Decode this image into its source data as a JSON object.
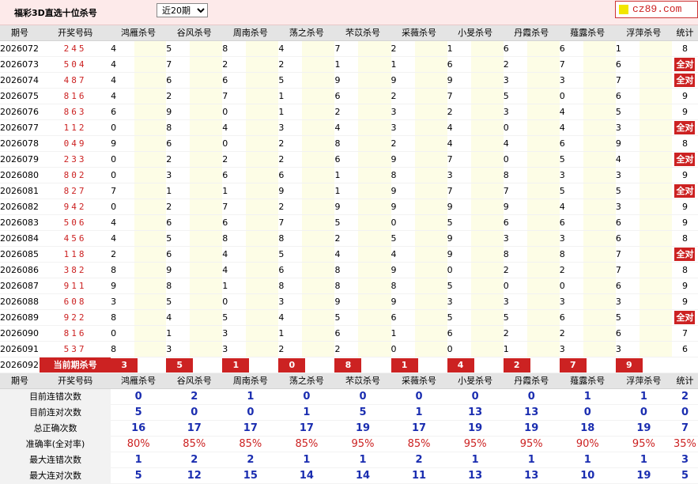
{
  "title": "福彩3D直选十位杀号",
  "period_select": {
    "selected": "近20期"
  },
  "logo": {
    "text": "cz89.com"
  },
  "headers": [
    "期号",
    "开奖号码",
    "鸿雁杀号",
    "谷风杀号",
    "周南杀号",
    "荡之杀号",
    "芣苡杀号",
    "采薇杀号",
    "小旻杀号",
    "丹霞杀号",
    "薤露杀号",
    "浮萍杀号",
    "统计"
  ],
  "rows": [
    {
      "period": "2026072",
      "draw": "245",
      "experts": [
        [
          4,
          0
        ],
        [
          5,
          1
        ],
        [
          8,
          1
        ],
        [
          4,
          0
        ],
        [
          7,
          1
        ],
        [
          2,
          1
        ],
        [
          1,
          1
        ],
        [
          6,
          1
        ],
        [
          6,
          1
        ],
        [
          1,
          1
        ]
      ],
      "stat": "8"
    },
    {
      "period": "2026073",
      "draw": "504",
      "experts": [
        [
          4,
          1
        ],
        [
          7,
          1
        ],
        [
          2,
          1
        ],
        [
          2,
          1
        ],
        [
          1,
          1
        ],
        [
          1,
          1
        ],
        [
          6,
          1
        ],
        [
          2,
          1
        ],
        [
          7,
          1
        ],
        [
          6,
          1
        ]
      ],
      "stat": "全对"
    },
    {
      "period": "2026074",
      "draw": "487",
      "experts": [
        [
          4,
          1
        ],
        [
          6,
          1
        ],
        [
          6,
          1
        ],
        [
          5,
          1
        ],
        [
          9,
          1
        ],
        [
          9,
          1
        ],
        [
          9,
          1
        ],
        [
          3,
          1
        ],
        [
          3,
          1
        ],
        [
          7,
          1
        ]
      ],
      "stat": "全对"
    },
    {
      "period": "2026075",
      "draw": "816",
      "experts": [
        [
          4,
          1
        ],
        [
          2,
          1
        ],
        [
          7,
          1
        ],
        [
          1,
          0
        ],
        [
          6,
          1
        ],
        [
          2,
          1
        ],
        [
          7,
          1
        ],
        [
          5,
          1
        ],
        [
          0,
          1
        ],
        [
          6,
          1
        ]
      ],
      "stat": "9"
    },
    {
      "period": "2026076",
      "draw": "863",
      "experts": [
        [
          6,
          0
        ],
        [
          9,
          1
        ],
        [
          0,
          1
        ],
        [
          1,
          1
        ],
        [
          2,
          1
        ],
        [
          3,
          1
        ],
        [
          2,
          1
        ],
        [
          3,
          1
        ],
        [
          4,
          1
        ],
        [
          5,
          1
        ]
      ],
      "stat": "9"
    },
    {
      "period": "2026077",
      "draw": "112",
      "experts": [
        [
          0,
          1
        ],
        [
          8,
          1
        ],
        [
          4,
          1
        ],
        [
          3,
          1
        ],
        [
          4,
          1
        ],
        [
          3,
          1
        ],
        [
          4,
          1
        ],
        [
          0,
          1
        ],
        [
          4,
          1
        ],
        [
          3,
          1
        ]
      ],
      "stat": "全对"
    },
    {
      "period": "2026078",
      "draw": "049",
      "experts": [
        [
          9,
          1
        ],
        [
          6,
          1
        ],
        [
          0,
          1
        ],
        [
          2,
          1
        ],
        [
          8,
          1
        ],
        [
          2,
          1
        ],
        [
          4,
          0
        ],
        [
          4,
          0
        ],
        [
          6,
          1
        ],
        [
          9,
          1
        ]
      ],
      "stat": "8"
    },
    {
      "period": "2026079",
      "draw": "233",
      "experts": [
        [
          0,
          1
        ],
        [
          2,
          1
        ],
        [
          2,
          1
        ],
        [
          2,
          1
        ],
        [
          6,
          1
        ],
        [
          9,
          1
        ],
        [
          7,
          1
        ],
        [
          0,
          1
        ],
        [
          5,
          1
        ],
        [
          4,
          1
        ]
      ],
      "stat": "全对"
    },
    {
      "period": "2026080",
      "draw": "802",
      "experts": [
        [
          0,
          0
        ],
        [
          3,
          1
        ],
        [
          6,
          1
        ],
        [
          6,
          1
        ],
        [
          1,
          1
        ],
        [
          8,
          1
        ],
        [
          3,
          1
        ],
        [
          8,
          1
        ],
        [
          3,
          1
        ],
        [
          3,
          1
        ]
      ],
      "stat": "9"
    },
    {
      "period": "2026081",
      "draw": "827",
      "experts": [
        [
          7,
          1
        ],
        [
          1,
          1
        ],
        [
          1,
          1
        ],
        [
          9,
          1
        ],
        [
          1,
          1
        ],
        [
          9,
          1
        ],
        [
          7,
          1
        ],
        [
          7,
          1
        ],
        [
          5,
          1
        ],
        [
          5,
          1
        ]
      ],
      "stat": "全对"
    },
    {
      "period": "2026082",
      "draw": "942",
      "experts": [
        [
          0,
          1
        ],
        [
          2,
          1
        ],
        [
          7,
          1
        ],
        [
          2,
          1
        ],
        [
          9,
          1
        ],
        [
          9,
          1
        ],
        [
          9,
          1
        ],
        [
          9,
          1
        ],
        [
          4,
          0
        ],
        [
          3,
          1
        ]
      ],
      "stat": "9"
    },
    {
      "period": "2026083",
      "draw": "506",
      "experts": [
        [
          4,
          1
        ],
        [
          6,
          1
        ],
        [
          6,
          1
        ],
        [
          7,
          1
        ],
        [
          5,
          1
        ],
        [
          0,
          0
        ],
        [
          5,
          1
        ],
        [
          6,
          1
        ],
        [
          6,
          1
        ],
        [
          6,
          1
        ]
      ],
      "stat": "9"
    },
    {
      "period": "2026084",
      "draw": "456",
      "experts": [
        [
          4,
          1
        ],
        [
          5,
          0
        ],
        [
          8,
          1
        ],
        [
          8,
          1
        ],
        [
          2,
          1
        ],
        [
          5,
          0
        ],
        [
          9,
          1
        ],
        [
          3,
          1
        ],
        [
          3,
          1
        ],
        [
          6,
          1
        ]
      ],
      "stat": "8"
    },
    {
      "period": "2026085",
      "draw": "118",
      "experts": [
        [
          2,
          1
        ],
        [
          6,
          1
        ],
        [
          4,
          1
        ],
        [
          5,
          1
        ],
        [
          4,
          1
        ],
        [
          4,
          1
        ],
        [
          9,
          1
        ],
        [
          8,
          1
        ],
        [
          8,
          1
        ],
        [
          7,
          1
        ]
      ],
      "stat": "全对"
    },
    {
      "period": "2026086",
      "draw": "382",
      "experts": [
        [
          8,
          0
        ],
        [
          9,
          1
        ],
        [
          4,
          1
        ],
        [
          6,
          1
        ],
        [
          8,
          0
        ],
        [
          9,
          1
        ],
        [
          0,
          1
        ],
        [
          2,
          1
        ],
        [
          2,
          1
        ],
        [
          7,
          1
        ]
      ],
      "stat": "8"
    },
    {
      "period": "2026087",
      "draw": "911",
      "experts": [
        [
          9,
          1
        ],
        [
          8,
          1
        ],
        [
          1,
          0
        ],
        [
          8,
          1
        ],
        [
          8,
          1
        ],
        [
          8,
          1
        ],
        [
          5,
          1
        ],
        [
          0,
          1
        ],
        [
          0,
          1
        ],
        [
          6,
          1
        ]
      ],
      "stat": "9"
    },
    {
      "period": "2026088",
      "draw": "608",
      "experts": [
        [
          3,
          1
        ],
        [
          5,
          1
        ],
        [
          0,
          0
        ],
        [
          3,
          1
        ],
        [
          9,
          1
        ],
        [
          9,
          1
        ],
        [
          3,
          1
        ],
        [
          3,
          1
        ],
        [
          3,
          1
        ],
        [
          3,
          1
        ]
      ],
      "stat": "9"
    },
    {
      "period": "2026089",
      "draw": "922",
      "experts": [
        [
          8,
          1
        ],
        [
          4,
          1
        ],
        [
          5,
          1
        ],
        [
          4,
          1
        ],
        [
          5,
          1
        ],
        [
          6,
          1
        ],
        [
          5,
          1
        ],
        [
          5,
          1
        ],
        [
          6,
          1
        ],
        [
          5,
          1
        ]
      ],
      "stat": "全对"
    },
    {
      "period": "2026090",
      "draw": "816",
      "experts": [
        [
          0,
          1
        ],
        [
          1,
          0
        ],
        [
          3,
          1
        ],
        [
          1,
          0
        ],
        [
          6,
          1
        ],
        [
          1,
          0
        ],
        [
          6,
          1
        ],
        [
          2,
          1
        ],
        [
          2,
          1
        ],
        [
          6,
          1
        ]
      ],
      "stat": "7"
    },
    {
      "period": "2026091",
      "draw": "537",
      "experts": [
        [
          8,
          1
        ],
        [
          3,
          0
        ],
        [
          3,
          0
        ],
        [
          2,
          1
        ],
        [
          2,
          1
        ],
        [
          0,
          1
        ],
        [
          0,
          1
        ],
        [
          1,
          1
        ],
        [
          3,
          0
        ],
        [
          3,
          0
        ]
      ],
      "stat": "6"
    }
  ],
  "current": {
    "period": "2026092",
    "label": "当前期杀号",
    "values": [
      "3",
      "5",
      "1",
      "0",
      "8",
      "1",
      "4",
      "2",
      "7",
      "9"
    ]
  },
  "stats": [
    {
      "label": "目前连错次数",
      "values": [
        "0",
        "2",
        "1",
        "0",
        "0",
        "0",
        "0",
        "0",
        "1",
        "1",
        "2"
      ],
      "red": false
    },
    {
      "label": "目前连对次数",
      "values": [
        "5",
        "0",
        "0",
        "1",
        "5",
        "1",
        "13",
        "13",
        "0",
        "0",
        "0"
      ],
      "red": false
    },
    {
      "label": "总正确次数",
      "values": [
        "16",
        "17",
        "17",
        "17",
        "19",
        "17",
        "19",
        "19",
        "18",
        "19",
        "7"
      ],
      "red": false
    },
    {
      "label": "准确率(全对率)",
      "values": [
        "80%",
        "85%",
        "85%",
        "85%",
        "95%",
        "85%",
        "95%",
        "95%",
        "90%",
        "95%",
        "35%"
      ],
      "red": true
    },
    {
      "label": "最大连错次数",
      "values": [
        "1",
        "2",
        "2",
        "1",
        "1",
        "2",
        "1",
        "1",
        "1",
        "1",
        "3"
      ],
      "red": false
    },
    {
      "label": "最大连对次数",
      "values": [
        "5",
        "12",
        "15",
        "14",
        "14",
        "11",
        "13",
        "13",
        "10",
        "19",
        "5"
      ],
      "red": false
    }
  ]
}
